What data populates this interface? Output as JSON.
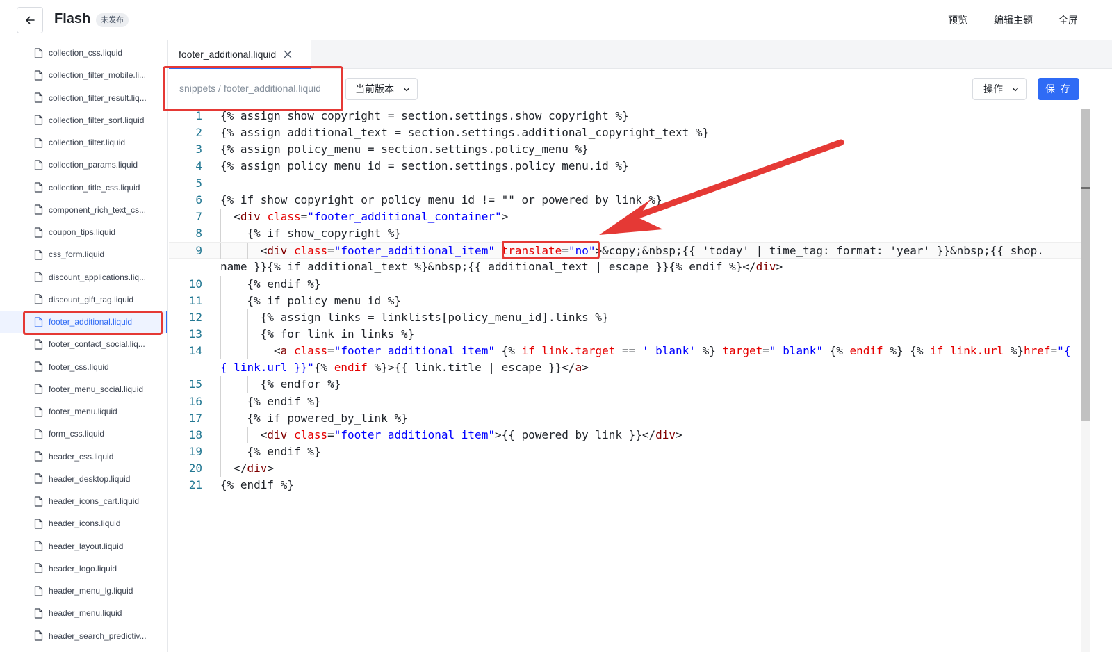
{
  "header": {
    "title": "Flash",
    "status_badge": "未发布",
    "actions": [
      "预览",
      "编辑主题",
      "全屏"
    ]
  },
  "sidebar": {
    "active_index": 12,
    "files": [
      "collection_css.liquid",
      "collection_filter_mobile.li...",
      "collection_filter_result.liq...",
      "collection_filter_sort.liquid",
      "collection_filter.liquid",
      "collection_params.liquid",
      "collection_title_css.liquid",
      "component_rich_text_cs...",
      "coupon_tips.liquid",
      "css_form.liquid",
      "discount_applications.liq...",
      "discount_gift_tag.liquid",
      "footer_additional.liquid",
      "footer_contact_social.liq...",
      "footer_css.liquid",
      "footer_menu_social.liquid",
      "footer_menu.liquid",
      "form_css.liquid",
      "header_css.liquid",
      "header_desktop.liquid",
      "header_icons_cart.liquid",
      "header_icons.liquid",
      "header_layout.liquid",
      "header_logo.liquid",
      "header_menu_lg.liquid",
      "header_menu.liquid",
      "header_search_predictiv..."
    ]
  },
  "tabs": [
    {
      "label": "footer_additional.liquid"
    }
  ],
  "toolbar": {
    "path": "snippets / footer_additional.liquid",
    "version_select": "当前版本",
    "operations_select": "操作",
    "save_label": "保 存"
  },
  "editor": {
    "current_line": 9,
    "lines": [
      {
        "num": "1",
        "indent": 0,
        "tokens": [
          [
            "t",
            "{% assign show_copyright = section.settings.show_copyright %}"
          ]
        ]
      },
      {
        "num": "2",
        "indent": 0,
        "tokens": [
          [
            "t",
            "{% assign additional_text = section.settings.additional_copyright_text %}"
          ]
        ]
      },
      {
        "num": "3",
        "indent": 0,
        "tokens": [
          [
            "t",
            "{% assign policy_menu = section.settings.policy_menu %}"
          ]
        ]
      },
      {
        "num": "4",
        "indent": 0,
        "tokens": [
          [
            "t",
            "{% assign policy_menu_id = section.settings.policy_menu.id %}"
          ]
        ]
      },
      {
        "num": "5",
        "indent": 0,
        "tokens": []
      },
      {
        "num": "6",
        "indent": 0,
        "tokens": [
          [
            "t",
            "{% if show_copyright or policy_menu_id != \"\" or powered_by_link %}"
          ]
        ]
      },
      {
        "num": "7",
        "indent": 1,
        "tokens": [
          [
            "t",
            "<"
          ],
          [
            "tag",
            "div"
          ],
          [
            "t",
            " "
          ],
          [
            "attr",
            "class"
          ],
          [
            "t",
            "="
          ],
          [
            "str",
            "\"footer_additional_container\""
          ],
          [
            "t",
            ">"
          ]
        ]
      },
      {
        "num": "8",
        "indent": 2,
        "tokens": [
          [
            "t",
            "{% if show_copyright %}"
          ]
        ]
      },
      {
        "num": "9",
        "indent": 3,
        "tokens": [
          [
            "t",
            "<"
          ],
          [
            "tag",
            "div"
          ],
          [
            "t",
            " "
          ],
          [
            "attr",
            "class"
          ],
          [
            "t",
            "="
          ],
          [
            "str",
            "\"footer_additional_item\""
          ],
          [
            "t",
            " "
          ],
          [
            "attr",
            "translate"
          ],
          [
            "t",
            "="
          ],
          [
            "str",
            "\"no\""
          ],
          [
            "t",
            ">&copy;&nbsp;{{ 'today' | time_tag: format: 'year' }}&nbsp;{{ shop."
          ]
        ]
      },
      {
        "num": "",
        "indent": -1,
        "tokens": [
          [
            "t",
            "name }}{% if additional_text %}&nbsp;{{ additional_text | escape }}{% endif %}</"
          ],
          [
            "tag",
            "div"
          ],
          [
            "t",
            ">"
          ]
        ]
      },
      {
        "num": "10",
        "indent": 2,
        "tokens": [
          [
            "t",
            "{% endif %}"
          ]
        ]
      },
      {
        "num": "11",
        "indent": 2,
        "tokens": [
          [
            "t",
            "{% if policy_menu_id %}"
          ]
        ]
      },
      {
        "num": "12",
        "indent": 3,
        "tokens": [
          [
            "t",
            "{% assign links = linklists[policy_menu_id].links %}"
          ]
        ]
      },
      {
        "num": "13",
        "indent": 3,
        "tokens": [
          [
            "t",
            "{% for link in links %}"
          ]
        ]
      },
      {
        "num": "14",
        "indent": 4,
        "tokens": [
          [
            "t",
            "<"
          ],
          [
            "tag",
            "a"
          ],
          [
            "t",
            " "
          ],
          [
            "attr",
            "class"
          ],
          [
            "t",
            "="
          ],
          [
            "str",
            "\"footer_additional_item\""
          ],
          [
            "t",
            " {% "
          ],
          [
            "kw",
            "if"
          ],
          [
            "t",
            " "
          ],
          [
            "kw",
            "link.target"
          ],
          [
            "t",
            " == "
          ],
          [
            "str",
            "'_blank'"
          ],
          [
            "t",
            " %} "
          ],
          [
            "attr",
            "target"
          ],
          [
            "t",
            "="
          ],
          [
            "str",
            "\"_blank\""
          ],
          [
            "t",
            " {% "
          ],
          [
            "kw",
            "endif"
          ],
          [
            "t",
            " %} {% "
          ],
          [
            "kw",
            "if"
          ],
          [
            "t",
            " "
          ],
          [
            "kw",
            "link.url"
          ],
          [
            "t",
            " %}"
          ],
          [
            "attr",
            "href"
          ],
          [
            "t",
            "="
          ],
          [
            "str",
            "\"{"
          ]
        ]
      },
      {
        "num": "",
        "indent": -1,
        "tokens": [
          [
            "str",
            "{ link.url }}\""
          ],
          [
            "t",
            "{% "
          ],
          [
            "kw",
            "endif"
          ],
          [
            "t",
            " %}>{{ link.title | escape }}</"
          ],
          [
            "tag",
            "a"
          ],
          [
            "t",
            ">"
          ]
        ]
      },
      {
        "num": "15",
        "indent": 3,
        "tokens": [
          [
            "t",
            "{% endfor %}"
          ]
        ]
      },
      {
        "num": "16",
        "indent": 2,
        "tokens": [
          [
            "t",
            "{% endif %}"
          ]
        ]
      },
      {
        "num": "17",
        "indent": 2,
        "tokens": [
          [
            "t",
            "{% if powered_by_link %}"
          ]
        ]
      },
      {
        "num": "18",
        "indent": 3,
        "tokens": [
          [
            "t",
            "<"
          ],
          [
            "tag",
            "div"
          ],
          [
            "t",
            " "
          ],
          [
            "attr",
            "class"
          ],
          [
            "t",
            "="
          ],
          [
            "str",
            "\"footer_additional_item\""
          ],
          [
            "t",
            ">{{ powered_by_link }}</"
          ],
          [
            "tag",
            "div"
          ],
          [
            "t",
            ">"
          ]
        ]
      },
      {
        "num": "19",
        "indent": 2,
        "tokens": [
          [
            "t",
            "{% endif %}"
          ]
        ]
      },
      {
        "num": "20",
        "indent": 1,
        "tokens": [
          [
            "t",
            "</"
          ],
          [
            "tag",
            "div"
          ],
          [
            "t",
            ">"
          ]
        ]
      },
      {
        "num": "21",
        "indent": 0,
        "tokens": [
          [
            "t",
            "{% endif %}"
          ]
        ]
      }
    ]
  },
  "annotations": {
    "color": "#e53935"
  }
}
